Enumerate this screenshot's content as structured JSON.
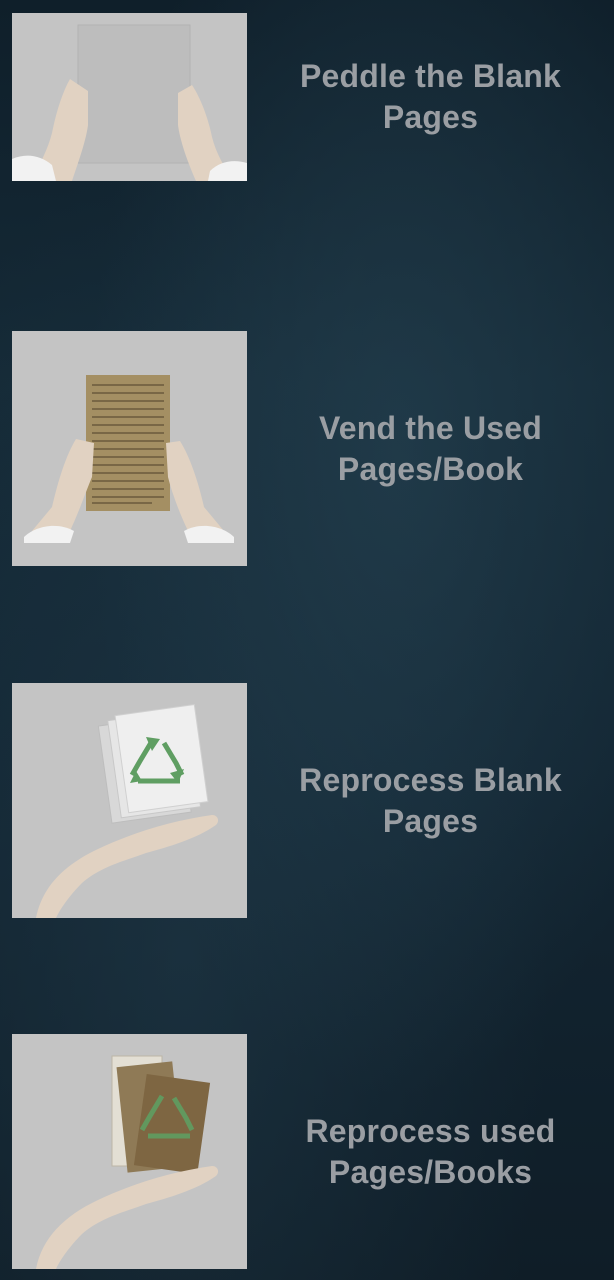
{
  "options": [
    {
      "label": "Peddle the Blank Pages",
      "icon": "hands-holding-blank-page-icon"
    },
    {
      "label": "Vend the Used Pages/Book",
      "icon": "hands-holding-used-page-icon"
    },
    {
      "label": "Reprocess Blank Pages",
      "icon": "hand-recycle-blank-pages-icon"
    },
    {
      "label": "Reprocess used Pages/Books",
      "icon": "hand-recycle-used-books-icon"
    }
  ],
  "colors": {
    "background": "#132633",
    "label_text": "#9a9ea3",
    "tile_bg": "#c3c3c3",
    "recycle_green": "#5f9e62"
  }
}
